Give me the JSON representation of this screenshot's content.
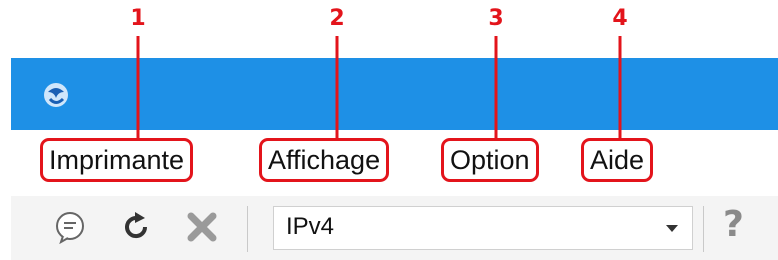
{
  "callouts": [
    "1",
    "2",
    "3",
    "4"
  ],
  "menu": {
    "items": [
      {
        "label": "Imprimante"
      },
      {
        "label": "Affichage"
      },
      {
        "label": "Option"
      },
      {
        "label": "Aide"
      }
    ]
  },
  "toolbar": {
    "icons": [
      "comment-icon",
      "refresh-icon",
      "delete-icon"
    ],
    "combo_value": "IPv4",
    "help_label": "?"
  },
  "colors": {
    "titlebar": "#1e90e6",
    "callout": "#e3141b",
    "toolbar": "#f4f4f4"
  }
}
